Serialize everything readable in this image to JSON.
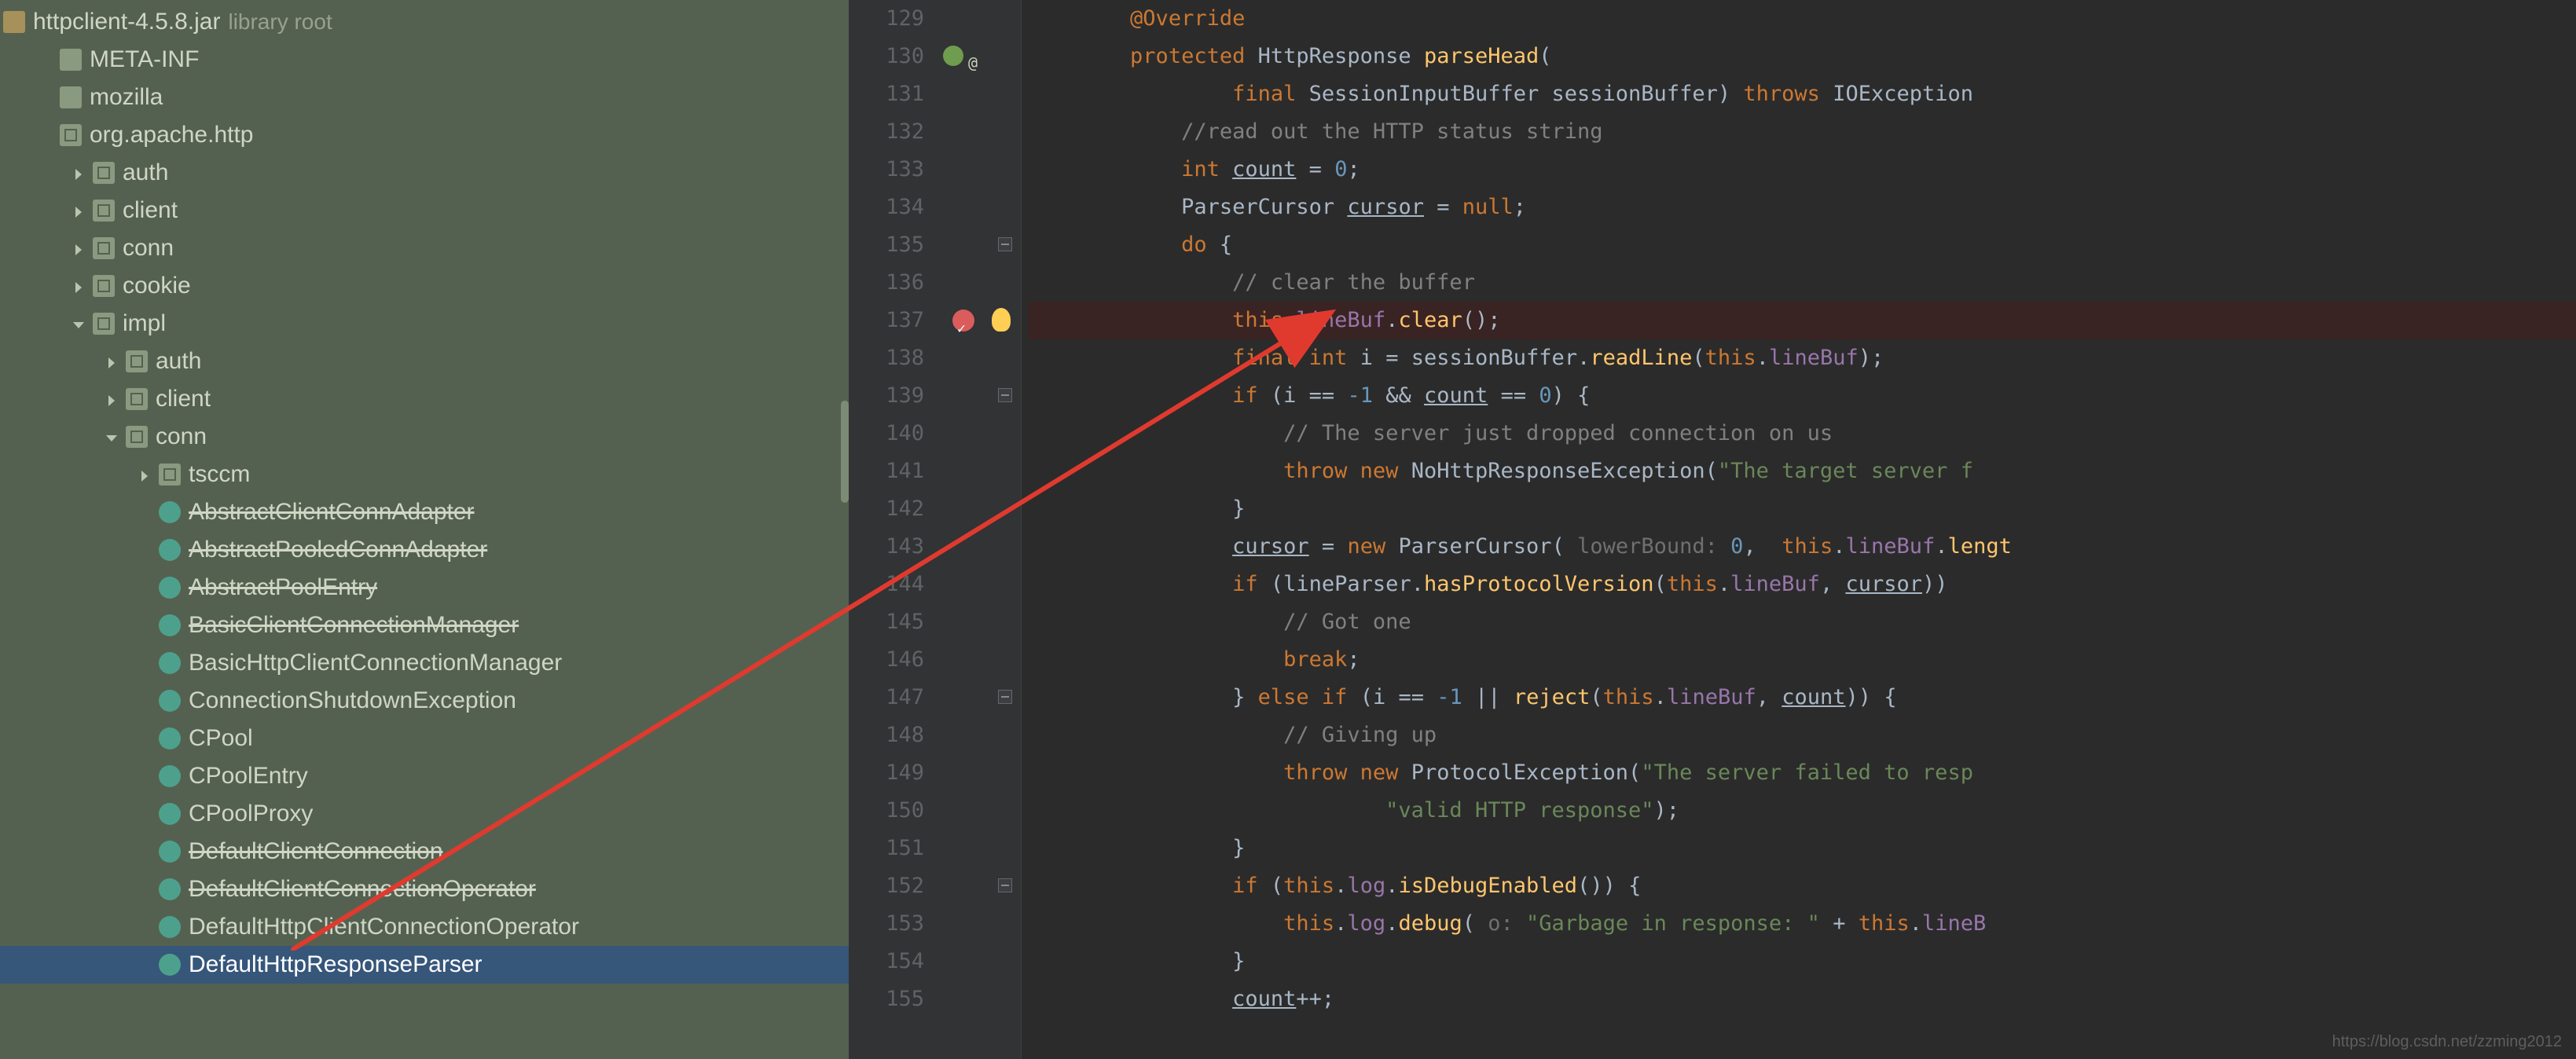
{
  "tree": {
    "root_label": "httpclient-4.5.8.jar",
    "root_suffix": "library root",
    "items": [
      {
        "indent": 1,
        "icon": "fol",
        "label": "META-INF"
      },
      {
        "indent": 1,
        "icon": "fol",
        "label": "mozilla"
      },
      {
        "indent": 1,
        "icon": "pkg",
        "label": "org.apache.http"
      },
      {
        "indent": 2,
        "icon": "pkg",
        "label": "auth",
        "chev": "r"
      },
      {
        "indent": 2,
        "icon": "pkg",
        "label": "client",
        "chev": "r"
      },
      {
        "indent": 2,
        "icon": "pkg",
        "label": "conn",
        "chev": "r"
      },
      {
        "indent": 2,
        "icon": "pkg",
        "label": "cookie",
        "chev": "r"
      },
      {
        "indent": 2,
        "icon": "pkg",
        "label": "impl",
        "chev": "d"
      },
      {
        "indent": 3,
        "icon": "pkg",
        "label": "auth",
        "chev": "r"
      },
      {
        "indent": 3,
        "icon": "pkg",
        "label": "client",
        "chev": "r"
      },
      {
        "indent": 3,
        "icon": "pkg",
        "label": "conn",
        "chev": "d"
      },
      {
        "indent": 4,
        "icon": "pkg",
        "label": "tsccm",
        "chev": "r"
      },
      {
        "indent": 4,
        "icon": "cls",
        "label": "AbstractClientConnAdapter",
        "strike": true
      },
      {
        "indent": 4,
        "icon": "cls",
        "label": "AbstractPooledConnAdapter",
        "strike": true
      },
      {
        "indent": 4,
        "icon": "cls",
        "label": "AbstractPoolEntry",
        "strike": true
      },
      {
        "indent": 4,
        "icon": "cls",
        "label": "BasicClientConnectionManager",
        "strike": true
      },
      {
        "indent": 4,
        "icon": "cls",
        "label": "BasicHttpClientConnectionManager"
      },
      {
        "indent": 4,
        "icon": "cls",
        "label": "ConnectionShutdownException"
      },
      {
        "indent": 4,
        "icon": "cls",
        "label": "CPool"
      },
      {
        "indent": 4,
        "icon": "cls",
        "label": "CPoolEntry"
      },
      {
        "indent": 4,
        "icon": "cls",
        "label": "CPoolProxy"
      },
      {
        "indent": 4,
        "icon": "cls",
        "label": "DefaultClientConnection",
        "strike": true
      },
      {
        "indent": 4,
        "icon": "cls",
        "label": "DefaultClientConnectionOperator",
        "strike": true
      },
      {
        "indent": 4,
        "icon": "cls",
        "label": "DefaultHttpClientConnectionOperator"
      },
      {
        "indent": 4,
        "icon": "cls",
        "label": "DefaultHttpResponseParser",
        "selected": true
      }
    ]
  },
  "editor": {
    "first_line": 129,
    "breakpoint_line": 137,
    "override_line": 130,
    "lines": {
      "129": {
        "html": "        <span class='kw'>@Override</span>"
      },
      "130": {
        "html": "        <span class='kw'>protected</span> <span class='ty'>HttpResponse</span> <span class='fn'>parseHead</span><span class='pun'>(</span>"
      },
      "131": {
        "html": "                <span class='kw'>final</span> <span class='ty'>SessionInputBuffer</span> <span class='id'>sessionBuffer</span><span class='pun'>)</span> <span class='kw'>throws</span> <span class='ty'>IOException</span>"
      },
      "132": {
        "html": "            <span class='cm'>//read out the HTTP status string</span>"
      },
      "133": {
        "html": "            <span class='kw'>int</span> <span class='id ul'>count</span> <span class='op'>=</span> <span class='num'>0</span><span class='pun'>;</span>"
      },
      "134": {
        "html": "            <span class='ty'>ParserCursor</span> <span class='id ul'>cursor</span> <span class='op'>=</span> <span class='kw'>null</span><span class='pun'>;</span>"
      },
      "135": {
        "html": "            <span class='kw'>do</span> <span class='pun'>{</span>"
      },
      "136": {
        "html": "                <span class='cm'>// clear the buffer</span>"
      },
      "137": {
        "html": "                <span class='kw'>this</span><span class='pun'>.</span><span class='field'>lineBuf</span><span class='pun'>.</span><span class='fn'>clear</span><span class='pun'>();</span>",
        "bp": true
      },
      "138": {
        "html": "                <span class='kw'>final</span> <span class='kw'>int</span> <span class='id'>i</span> <span class='op'>=</span> <span class='id'>sessionBuffer</span><span class='pun'>.</span><span class='fn'>readLine</span><span class='pun'>(</span><span class='kw'>this</span><span class='pun'>.</span><span class='field'>lineBuf</span><span class='pun'>);</span>"
      },
      "139": {
        "html": "                <span class='kw'>if</span> <span class='pun'>(</span><span class='id'>i</span> <span class='op'>==</span> <span class='num'>-1</span> <span class='op'>&amp;&amp;</span> <span class='id ul'>count</span> <span class='op'>==</span> <span class='num'>0</span><span class='pun'>) {</span>"
      },
      "140": {
        "html": "                    <span class='cm'>// The server just dropped connection on us</span>"
      },
      "141": {
        "html": "                    <span class='kw'>throw</span> <span class='kw'>new</span> <span class='ty'>NoHttpResponseException</span><span class='pun'>(</span><span class='str'>\"The target server f</span>"
      },
      "142": {
        "html": "                <span class='pun'>}</span>"
      },
      "143": {
        "html": "                <span class='id ul'>cursor</span> <span class='op'>=</span> <span class='kw'>new</span> <span class='ty'>ParserCursor</span><span class='pun'>(</span> <span class='hint'>lowerBound:</span> <span class='num'>0</span><span class='pun'>,</span>  <span class='kw'>this</span><span class='pun'>.</span><span class='field'>lineBuf</span><span class='pun'>.</span><span class='fn'>lengt</span>"
      },
      "144": {
        "html": "                <span class='kw'>if</span> <span class='pun'>(</span><span class='id'>lineParser</span><span class='pun'>.</span><span class='fn'>hasProtocolVersion</span><span class='pun'>(</span><span class='kw'>this</span><span class='pun'>.</span><span class='field'>lineBuf</span><span class='pun'>,</span> <span class='id ul'>cursor</span><span class='pun'>)) </span>"
      },
      "145": {
        "html": "                    <span class='cm'>// Got one</span>"
      },
      "146": {
        "html": "                    <span class='kw'>break</span><span class='pun'>;</span>"
      },
      "147": {
        "html": "                <span class='pun'>}</span> <span class='kw'>else if</span> <span class='pun'>(</span><span class='id'>i</span> <span class='op'>==</span> <span class='num'>-1</span> <span class='op'>||</span> <span class='fn'>reject</span><span class='pun'>(</span><span class='kw'>this</span><span class='pun'>.</span><span class='field'>lineBuf</span><span class='pun'>,</span> <span class='id ul'>count</span><span class='pun'>)) {</span>"
      },
      "148": {
        "html": "                    <span class='cm'>// Giving up</span>"
      },
      "149": {
        "html": "                    <span class='kw'>throw</span> <span class='kw'>new</span> <span class='ty'>ProtocolException</span><span class='pun'>(</span><span class='str'>\"The server failed to resp</span>"
      },
      "150": {
        "html": "                            <span class='str'>\"valid HTTP response\"</span><span class='pun'>);</span>"
      },
      "151": {
        "html": "                <span class='pun'>}</span>"
      },
      "152": {
        "html": "                <span class='kw'>if</span> <span class='pun'>(</span><span class='kw'>this</span><span class='pun'>.</span><span class='field'>log</span><span class='pun'>.</span><span class='fn'>isDebugEnabled</span><span class='pun'>()) {</span>"
      },
      "153": {
        "html": "                    <span class='kw'>this</span><span class='pun'>.</span><span class='field'>log</span><span class='pun'>.</span><span class='fn'>debug</span><span class='pun'>(</span> <span class='hint'>o:</span> <span class='str'>\"Garbage in response: \"</span> <span class='op'>+</span> <span class='kw'>this</span><span class='pun'>.</span><span class='field'>lineB</span>"
      },
      "154": {
        "html": "                <span class='pun'>}</span>"
      },
      "155": {
        "html": "                <span class='id ul'>count</span><span class='op'>++</span><span class='pun'>;</span>"
      }
    }
  },
  "watermark": "https://blog.csdn.net/zzming2012"
}
